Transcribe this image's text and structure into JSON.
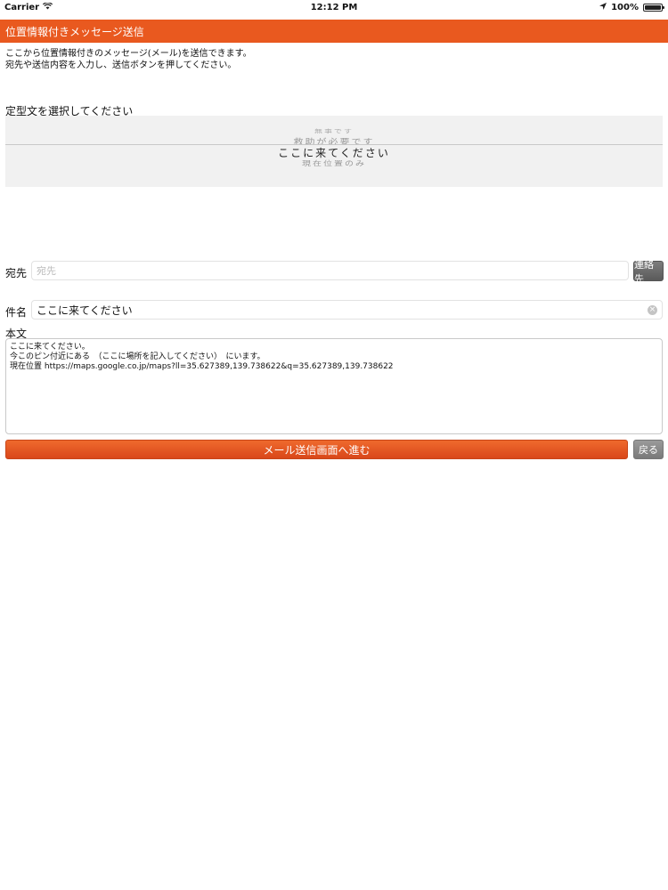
{
  "status_bar": {
    "carrier": "Carrier",
    "time": "12:12 PM",
    "battery": "100%",
    "icons": [
      "wifi-icon",
      "location-arrow-icon",
      "battery-icon"
    ]
  },
  "nav": {
    "title": "位置情報付きメッセージ送信",
    "color": "#e9591f"
  },
  "description": {
    "line1": "ここから位置情報付きのメッセージ(メール)を送信できます。",
    "line2": "宛先や送信内容を入力し、送信ボタンを押してください。"
  },
  "template_picker": {
    "label": "定型文を選択してください",
    "options": [
      "無事です",
      "救助が必要です",
      "ここに来てください",
      "現在位置のみ"
    ],
    "selected": "ここに来てください"
  },
  "to": {
    "label": "宛先",
    "placeholder": "宛先",
    "value": "",
    "contacts_button": "連絡先"
  },
  "subject": {
    "label": "件名",
    "value": "ここに来てください"
  },
  "body": {
    "label": "本文",
    "value": "ここに来てください。\n今このピン付近にある　（ここに場所を記入してください）　にいます。\n現在位置 https://maps.google.co.jp/maps?ll=35.627389,139.738622&q=35.627389,139.738622"
  },
  "actions": {
    "send_label": "メール送信画面へ進む",
    "back_label": "戻る"
  }
}
